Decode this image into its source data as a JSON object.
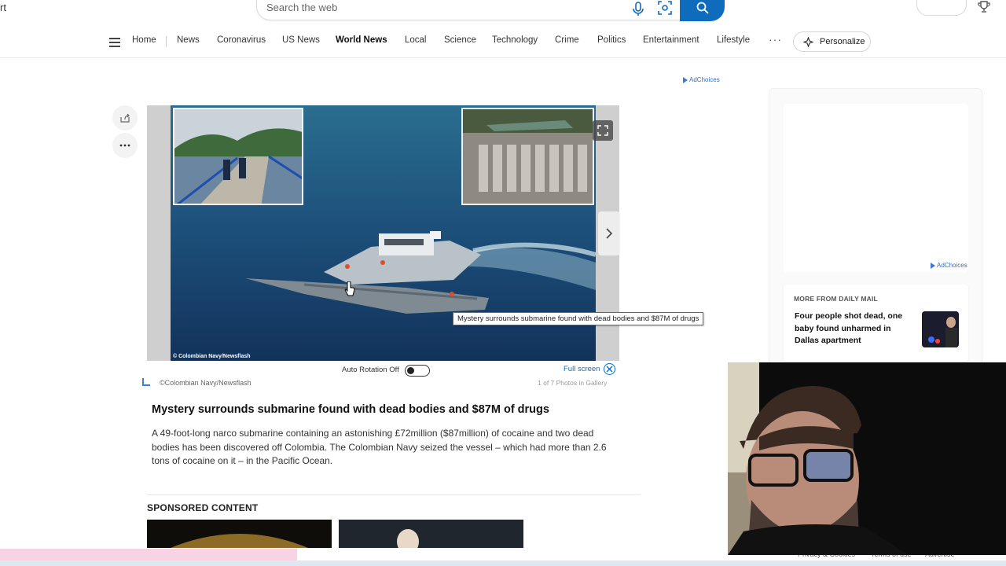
{
  "header": {
    "brand_fragment": "rt",
    "search_placeholder": "Search the web"
  },
  "nav": {
    "items": [
      {
        "label": "Home"
      },
      {
        "label": "News"
      },
      {
        "label": "Coronavirus"
      },
      {
        "label": "US News"
      },
      {
        "label": "World News",
        "active": true
      },
      {
        "label": "Local"
      },
      {
        "label": "Science"
      },
      {
        "label": "Technology"
      },
      {
        "label": "Crime"
      },
      {
        "label": "Politics"
      },
      {
        "label": "Entertainment"
      },
      {
        "label": "Lifestyle"
      }
    ],
    "more_label": "···",
    "personalize_label": "Personalize"
  },
  "ads": {
    "adchoices_label": "AdChoices"
  },
  "gallery": {
    "photo_credit_overlay": "© Colombian Navy/Newsflash",
    "tooltip": "Mystery surrounds submarine found with dead bodies and $87M of drugs",
    "auto_rotation_label": "Auto Rotation Off",
    "fullscreen_label": "Full screen",
    "credit": "©Colombian Navy/Newsflash",
    "counter": "1 of 7 Photos in Gallery"
  },
  "article": {
    "headline": "Mystery surrounds submarine found with dead bodies and $87M of drugs",
    "summary": "A 49-foot-long narco submarine containing an astonishing £72million ($87million) of cocaine and two dead bodies has been discovered off Colombia. The Colombian Navy seized the vessel – which had more than 2.6 tons of cocaine on it – in the Pacific Ocean."
  },
  "sponsored": {
    "heading": "SPONSORED CONTENT"
  },
  "rail": {
    "more_from_label": "MORE FROM DAILY MAIL",
    "story_title": "Four people shot dead, one baby found unharmed in Dallas apartment"
  },
  "footer": {
    "links": [
      "Privacy & Cookies",
      "Terms of use",
      "Advertise"
    ]
  },
  "colors": {
    "accent": "#0f6cbd",
    "link": "#3a6fb3"
  }
}
